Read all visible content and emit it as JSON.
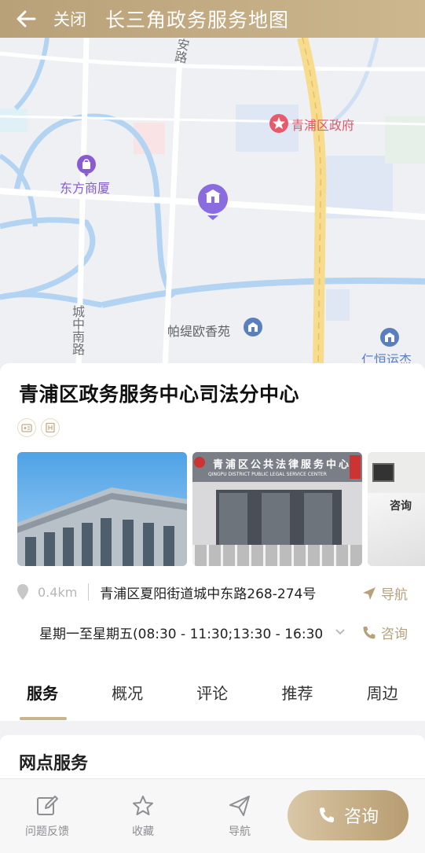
{
  "header": {
    "back_icon": "arrow-left-icon",
    "close_label": "关闭",
    "title": "长三角政务服务地图"
  },
  "map": {
    "pois": [
      {
        "label": "青浦区政府",
        "icon": "star-pin-icon",
        "color": "#e75a6b"
      },
      {
        "label": "东方商厦",
        "icon": "shopping-bag-pin-icon",
        "color": "#8a5cd1"
      },
      {
        "label": "帕缇欧香苑",
        "icon": "building-pin-icon",
        "color": "#5b7fbd"
      },
      {
        "label": "仁恒运杰",
        "icon": "building-pin-icon",
        "color": "#5b7fbd"
      }
    ],
    "roads": {
      "road_1": "安路",
      "road_2": "城中南路"
    },
    "selected_pin_icon": "government-pin-icon"
  },
  "card": {
    "name": "青浦区政务服务中心司法分中心",
    "tag_icons": [
      "accessible-icon",
      "building-icon"
    ],
    "photo_sign_text": {
      "cn": "青浦区公共法律服务中心",
      "en": "QINGPU DISTRICT PUBLIC LEGAL SERVICE CENTER",
      "desk": "咨询"
    },
    "distance": "0.4km",
    "address": "青浦区夏阳街道城中东路268-274号",
    "nav_label": "导航",
    "hours": "星期一至星期五(08:30 - 11:30;13:30 - 16:30",
    "consult_label": "咨询",
    "tabs": [
      "服务",
      "概况",
      "评论",
      "推荐",
      "周边"
    ],
    "active_tab": "服务"
  },
  "section": {
    "title": "网点服务"
  },
  "bottom_bar": {
    "feedback_label": "问题反馈",
    "favorite_label": "收藏",
    "navigate_label": "导航",
    "consult_button_label": "咨询"
  },
  "colors": {
    "accent": "#b7a17c",
    "header_bg": "#c5ae86"
  }
}
